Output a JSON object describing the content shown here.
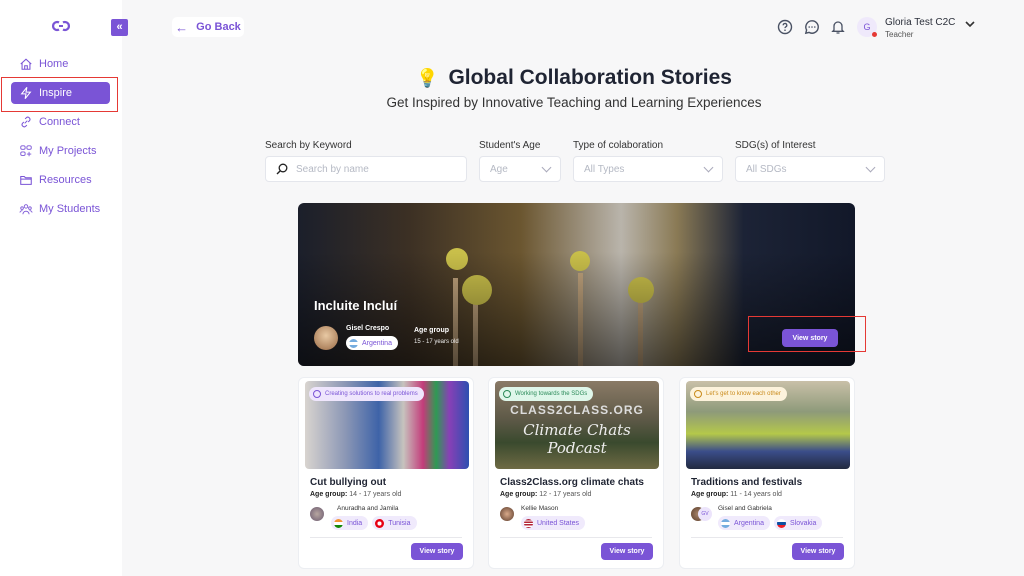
{
  "sidebar": {
    "collapse_icon": "chevrons-left-icon",
    "items": [
      {
        "label": "Home",
        "icon": "home-icon"
      },
      {
        "label": "Inspire",
        "icon": "lightning-icon",
        "active": true
      },
      {
        "label": "Connect",
        "icon": "link-icon"
      },
      {
        "label": "My Projects",
        "icon": "grid-plus-icon"
      },
      {
        "label": "Resources",
        "icon": "folder-icon"
      },
      {
        "label": "My Students",
        "icon": "users-icon"
      }
    ]
  },
  "header": {
    "go_back": "Go Back",
    "user": {
      "initial": "G",
      "name": "Gloria Test C2C",
      "role": "Teacher"
    }
  },
  "page": {
    "title_icon": "💡",
    "title": "Global Collaboration Stories",
    "subtitle": "Get Inspired by Innovative Teaching and Learning Experiences"
  },
  "filters": {
    "keyword": {
      "label": "Search by Keyword",
      "placeholder": "Search by name"
    },
    "age": {
      "label": "Student's Age",
      "value": "Age"
    },
    "type": {
      "label": "Type of colaboration",
      "value": "All Types"
    },
    "sdg": {
      "label": "SDG(s) of Interest",
      "value": "All SDGs"
    }
  },
  "featured": {
    "title": "Incluite Incluí",
    "author": "Gisel Crespo",
    "country": "Argentina",
    "age_label": "Age group",
    "age_value": "15 - 17 years old",
    "button": "View story"
  },
  "cards": [
    {
      "badge": "Creating solutions to real problems",
      "title": "Cut bullying out",
      "age_label": "Age group:",
      "age_value": "14 - 17 years old",
      "authors": "Anuradha and Jamila",
      "countries": [
        "India",
        "Tunisia"
      ],
      "button": "View story"
    },
    {
      "badge": "Working towards the SDGs",
      "title": "Class2Class.org climate chats",
      "age_label": "Age group:",
      "age_value": "12 - 17 years old",
      "authors": "Kellie Mason",
      "countries": [
        "United States"
      ],
      "image_text_1": "CLASS2CLASS.ORG",
      "image_text_2": "Climate Chats Podcast",
      "button": "View story"
    },
    {
      "badge": "Let's get to know each other",
      "title": "Traditions and festivals",
      "age_label": "Age group:",
      "age_value": "11 - 14 years old",
      "authors": "Gisel and Gabriela",
      "avatar_initials": "GV",
      "countries": [
        "Argentina",
        "Slovakia"
      ],
      "button": "View story"
    }
  ],
  "colors": {
    "accent": "#7a54d6",
    "highlight": "#e53935"
  }
}
